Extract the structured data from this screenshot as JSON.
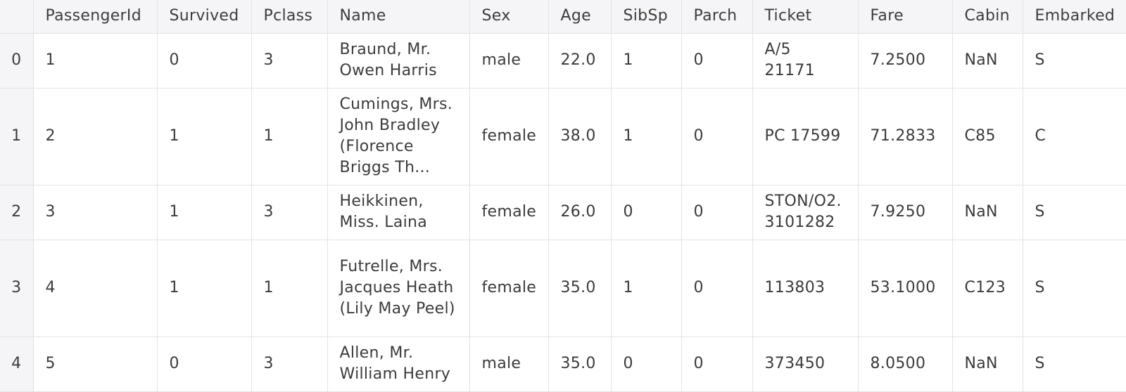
{
  "table": {
    "index_header": "",
    "columns": [
      "PassengerId",
      "Survived",
      "Pclass",
      "Name",
      "Sex",
      "Age",
      "SibSp",
      "Parch",
      "Ticket",
      "Fare",
      "Cabin",
      "Embarked"
    ],
    "rows": [
      {
        "index": "0",
        "PassengerId": "1",
        "Survived": "0",
        "Pclass": "3",
        "Name": "Braund, Mr. Owen Harris",
        "Sex": "male",
        "Age": "22.0",
        "SibSp": "1",
        "Parch": "0",
        "Ticket": "A/5 21171",
        "Fare": "7.2500",
        "Cabin": "NaN",
        "Embarked": "S"
      },
      {
        "index": "1",
        "PassengerId": "2",
        "Survived": "1",
        "Pclass": "1",
        "Name": "Cumings, Mrs. John Bradley (Florence Briggs Th...",
        "Sex": "female",
        "Age": "38.0",
        "SibSp": "1",
        "Parch": "0",
        "Ticket": "PC 17599",
        "Fare": "71.2833",
        "Cabin": "C85",
        "Embarked": "C"
      },
      {
        "index": "2",
        "PassengerId": "3",
        "Survived": "1",
        "Pclass": "3",
        "Name": "Heikkinen, Miss. Laina",
        "Sex": "female",
        "Age": "26.0",
        "SibSp": "0",
        "Parch": "0",
        "Ticket": "STON/O2. 3101282",
        "Fare": "7.9250",
        "Cabin": "NaN",
        "Embarked": "S"
      },
      {
        "index": "3",
        "PassengerId": "4",
        "Survived": "1",
        "Pclass": "1",
        "Name": "Futrelle, Mrs. Jacques Heath (Lily May Peel)",
        "Sex": "female",
        "Age": "35.0",
        "SibSp": "1",
        "Parch": "0",
        "Ticket": "113803",
        "Fare": "53.1000",
        "Cabin": "C123",
        "Embarked": "S"
      },
      {
        "index": "4",
        "PassengerId": "5",
        "Survived": "0",
        "Pclass": "3",
        "Name": "Allen, Mr. William Henry",
        "Sex": "male",
        "Age": "35.0",
        "SibSp": "0",
        "Parch": "0",
        "Ticket": "373450",
        "Fare": "8.0500",
        "Cabin": "NaN",
        "Embarked": "S"
      }
    ]
  },
  "colors": {
    "header_background": "#f5f5f7",
    "grid_line": "#e3e3e6",
    "text": "#3b3b3b"
  }
}
